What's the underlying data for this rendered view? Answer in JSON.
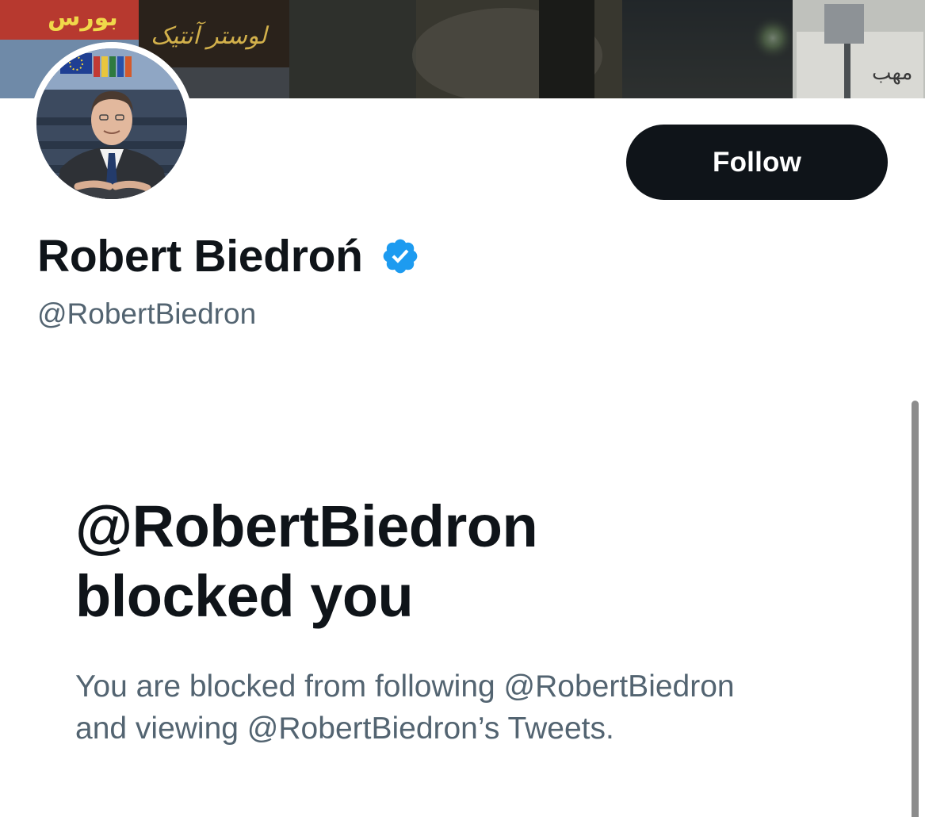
{
  "profile": {
    "display_name": "Robert Biedroń",
    "handle": "@RobertBiedron",
    "verified_icon": "verified-badge-icon",
    "follow_label": "Follow"
  },
  "banner": {
    "sign_left": "بورس",
    "sign_center": "لوستر آنتیک"
  },
  "blocked": {
    "title_line1": "@RobertBiedron",
    "title_line2": "blocked you",
    "description_line1": "You are blocked from following @RobertBiedron",
    "description_line2": "and viewing @RobertBiedron’s Tweets."
  },
  "colors": {
    "text_primary": "#0f1419",
    "text_secondary": "#536471",
    "verified_blue": "#1d9bf0",
    "button_bg": "#0f1419",
    "button_text": "#ffffff"
  }
}
